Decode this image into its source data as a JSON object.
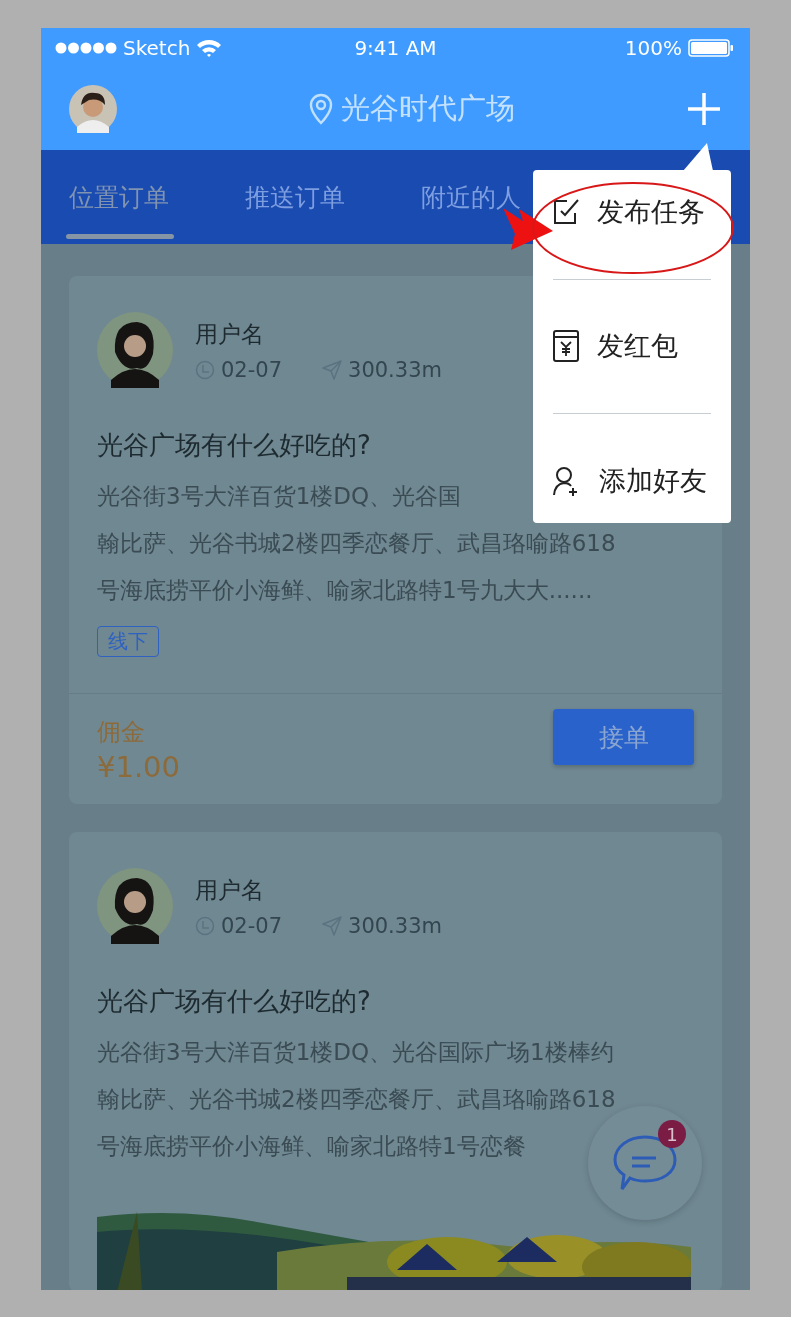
{
  "status_bar": {
    "carrier": "Sketch",
    "time": "9:41 AM",
    "battery": "100%"
  },
  "nav": {
    "location": "光谷时代广场"
  },
  "tabs": [
    {
      "label": "位置订单",
      "selected": true
    },
    {
      "label": "推送订单",
      "selected": false
    },
    {
      "label": "附近的人",
      "selected": false
    }
  ],
  "posts": [
    {
      "user": "用户名",
      "date": "02-07",
      "distance": "300.33m",
      "title": "光谷广场有什么好吃的?",
      "lines": [
        "光谷街3号大洋百货1楼DQ、光谷国",
        "翰比萨、光谷书城2楼四季恋餐厅、武昌珞喻路618",
        "号海底捞平价小海鲜、喻家北路特1号九大大......"
      ],
      "tag": "线下",
      "commission_label": "佣金",
      "price": "¥1.00",
      "action": "接单"
    },
    {
      "user": "用户名",
      "date": "02-07",
      "distance": "300.33m",
      "title": "光谷广场有什么好吃的?",
      "lines": [
        "光谷街3号大洋百货1楼DQ、光谷国际广场1楼棒约",
        "翰比萨、光谷书城2楼四季恋餐厅、武昌珞喻路618",
        "号海底捞平价小海鲜、喻家北路特1号恋餐"
      ]
    }
  ],
  "menu": {
    "items": [
      {
        "kind": "task",
        "label": "发布任务"
      },
      {
        "kind": "redpacket",
        "label": "发红包"
      },
      {
        "kind": "friend",
        "label": "添加好友"
      }
    ]
  },
  "chat": {
    "badge": "1"
  }
}
